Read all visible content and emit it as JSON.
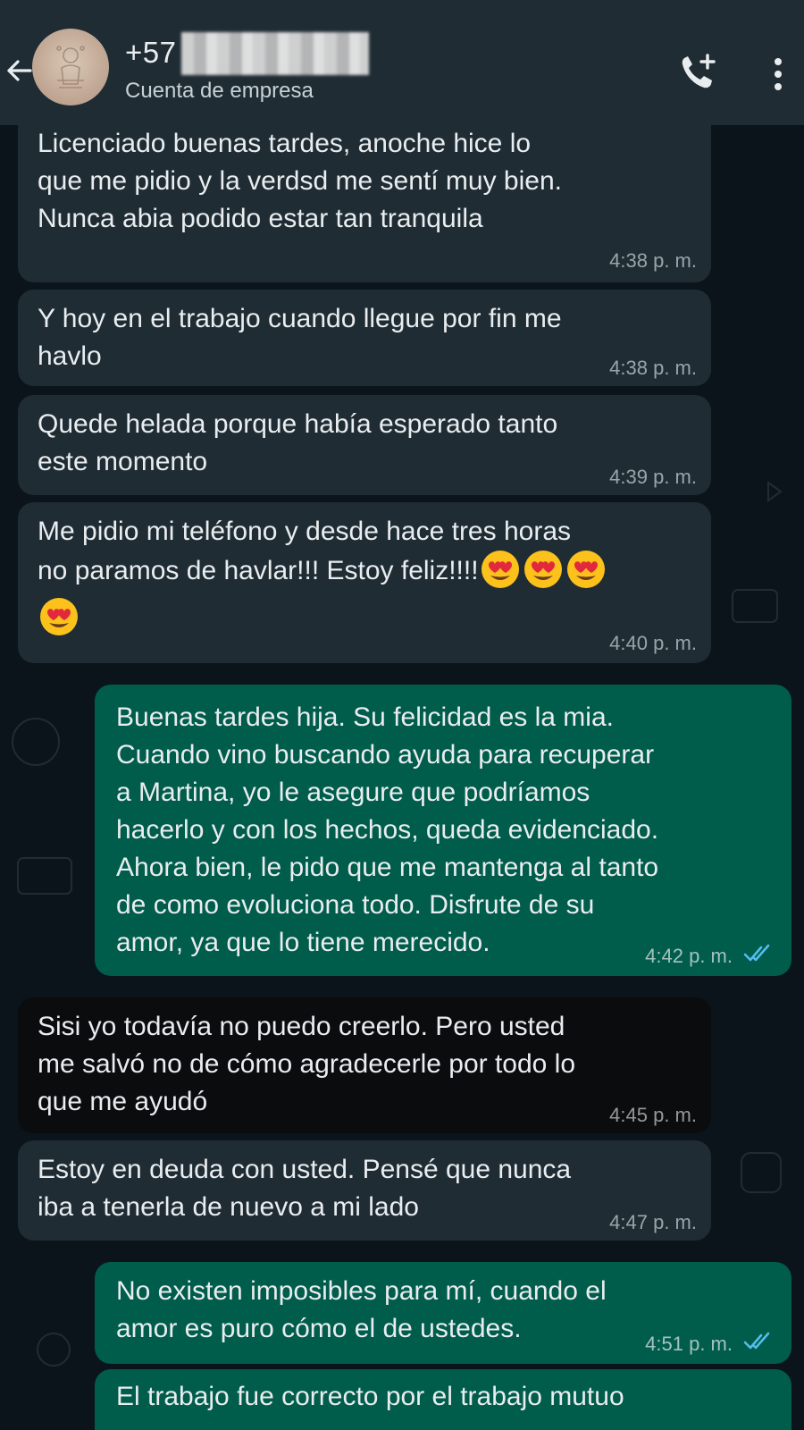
{
  "header": {
    "contact_prefix": "+57",
    "account_type": "Cuenta de empresa",
    "back_icon": "arrow-left-icon",
    "call_icon": "phone-plus-icon",
    "menu_icon": "vertical-dots-icon"
  },
  "colors": {
    "header_bg": "#1f2c34",
    "incoming_bg": "#1f2c34",
    "outgoing_bg": "#005c4b",
    "read_ticks": "#53bdeb"
  },
  "messages": [
    {
      "text": "Licenciado buenas tardes, anoche hice lo\nque me pidio y la verdsd me sentí muy bien.\nNunca abia podido estar tan tranquila",
      "time": "4:38 p. m."
    },
    {
      "text": "Y hoy en el trabajo cuando llegue por fin me\nhavlo",
      "time": "4:38 p. m."
    },
    {
      "text": "Quede helada porque había esperado tanto\neste momento",
      "time": "4:39 p. m."
    },
    {
      "text_line1": "Me pidio mi teléfono y desde hace tres horas",
      "text_line2": "no paramos de havlar!!! Estoy feliz!!!!",
      "emoji": "heart-eyes-emoji",
      "time": "4:40 p. m."
    },
    {
      "text": "Buenas tardes hija. Su felicidad es la mia.\nCuando vino buscando ayuda para recuperar\na Martina, yo le asegure que podríamos\nhacerlo y con los hechos, queda evidenciado.\nAhora bien, le pido que me mantenga al tanto\nde como evoluciona todo. Disfrute de su\namor, ya que lo tiene merecido.",
      "time": "4:42 p. m."
    },
    {
      "text": "Sisi yo todavía no puedo creerlo. Pero usted\nme salvó no de cómo agradecerle por todo lo\nque me ayudó",
      "time": "4:45 p. m."
    },
    {
      "text": "Estoy en deuda con usted. Pensé que nunca\niba a tenerla de nuevo a mi lado",
      "time": "4:47 p. m."
    },
    {
      "text": "No existen imposibles para mí, cuando el\namor es puro cómo el de ustedes.",
      "time": "4:51 p. m."
    },
    {
      "text": "El trabajo fue correcto por el trabajo mutuo"
    }
  ]
}
